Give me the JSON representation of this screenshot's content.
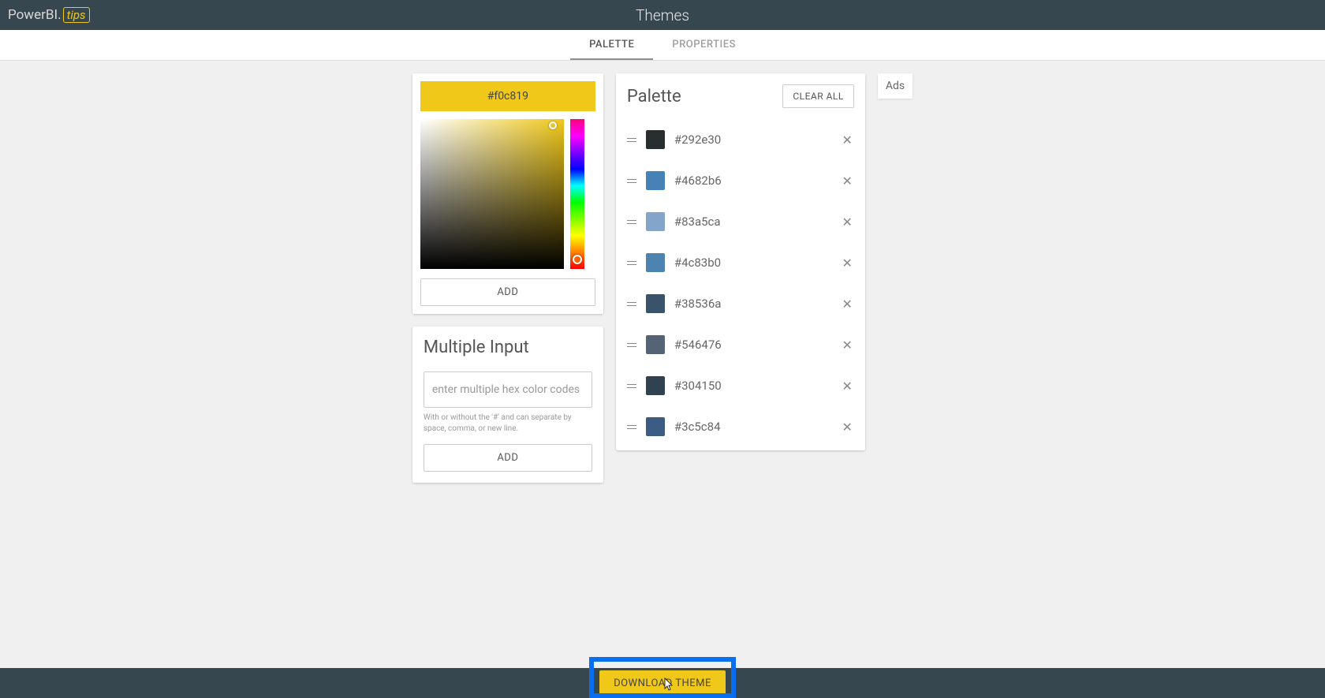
{
  "logo": {
    "prefix": "PowerBI.",
    "suffix": "tips"
  },
  "page_title": "Themes",
  "tabs": {
    "palette": "PALETTE",
    "properties": "PROPERTIES"
  },
  "picker": {
    "current_hex": "#f0c819",
    "add_label": "ADD"
  },
  "multi": {
    "title": "Multiple Input",
    "placeholder": "enter multiple hex color codes",
    "helper": "With or without the '#' and can separate by space, comma, or new line.",
    "add_label": "ADD"
  },
  "palette": {
    "title": "Palette",
    "clear_label": "CLEAR ALL",
    "colors": [
      {
        "hex": "#292e30"
      },
      {
        "hex": "#4682b6"
      },
      {
        "hex": "#83a5ca"
      },
      {
        "hex": "#4c83b0"
      },
      {
        "hex": "#38536a"
      },
      {
        "hex": "#546476"
      },
      {
        "hex": "#304150"
      },
      {
        "hex": "#3c5c84"
      }
    ]
  },
  "ads_label": "Ads",
  "download_label": "DOWNLOAD THEME"
}
